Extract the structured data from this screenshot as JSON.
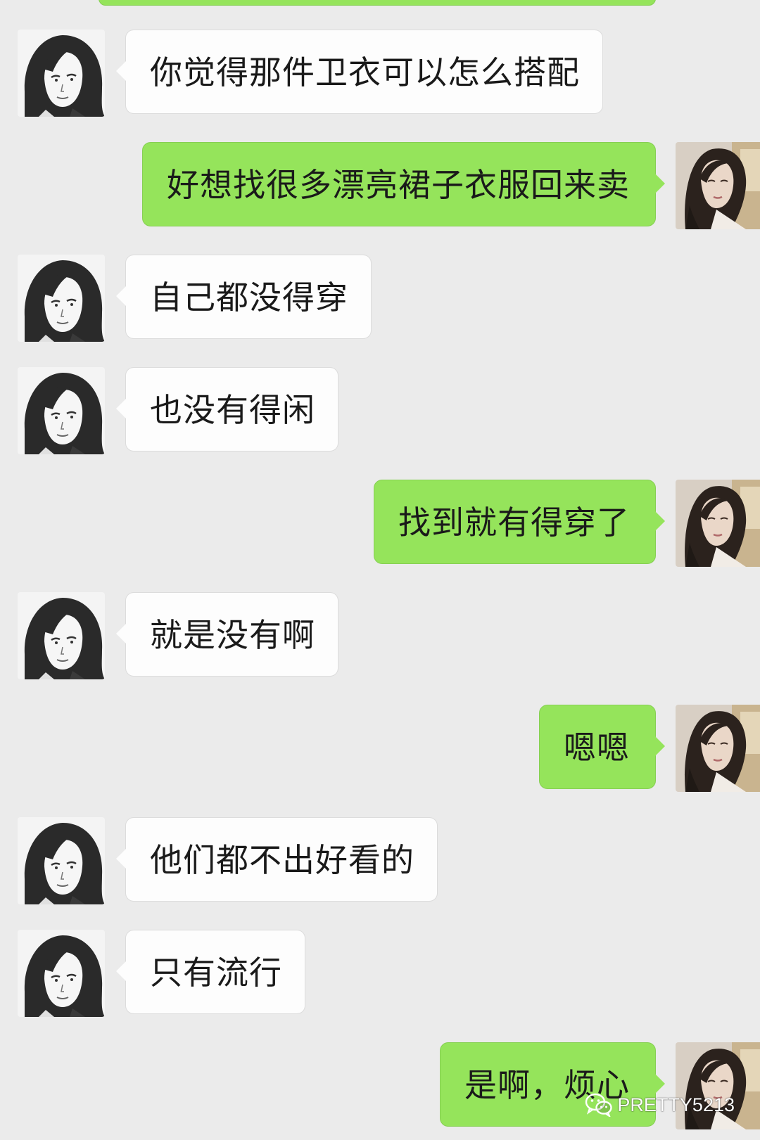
{
  "conversation": {
    "messages": [
      {
        "side": "left",
        "text": "你觉得那件卫衣可以怎么搭配",
        "avatar": "contact-avatar"
      },
      {
        "side": "right",
        "text": "好想找很多漂亮裙子衣服回来卖",
        "avatar": "self-avatar"
      },
      {
        "side": "left",
        "text": "自己都没得穿",
        "avatar": "contact-avatar"
      },
      {
        "side": "left",
        "text": "也没有得闲",
        "avatar": "contact-avatar"
      },
      {
        "side": "right",
        "text": "找到就有得穿了",
        "avatar": "self-avatar"
      },
      {
        "side": "left",
        "text": "就是没有啊",
        "avatar": "contact-avatar"
      },
      {
        "side": "right",
        "text": "嗯嗯",
        "avatar": "self-avatar"
      },
      {
        "side": "left",
        "text": "他们都不出好看的",
        "avatar": "contact-avatar"
      },
      {
        "side": "left",
        "text": "只有流行",
        "avatar": "contact-avatar"
      },
      {
        "side": "right",
        "text": "是啊，烦心",
        "avatar": "self-avatar"
      }
    ]
  },
  "watermark": {
    "icon": "wechat-icon",
    "text": "PRETTY5213"
  },
  "colors": {
    "background": "#ebebeb",
    "sent_bubble": "#95e45b",
    "received_bubble": "#fdfdfd",
    "text": "#1a1a1a"
  }
}
